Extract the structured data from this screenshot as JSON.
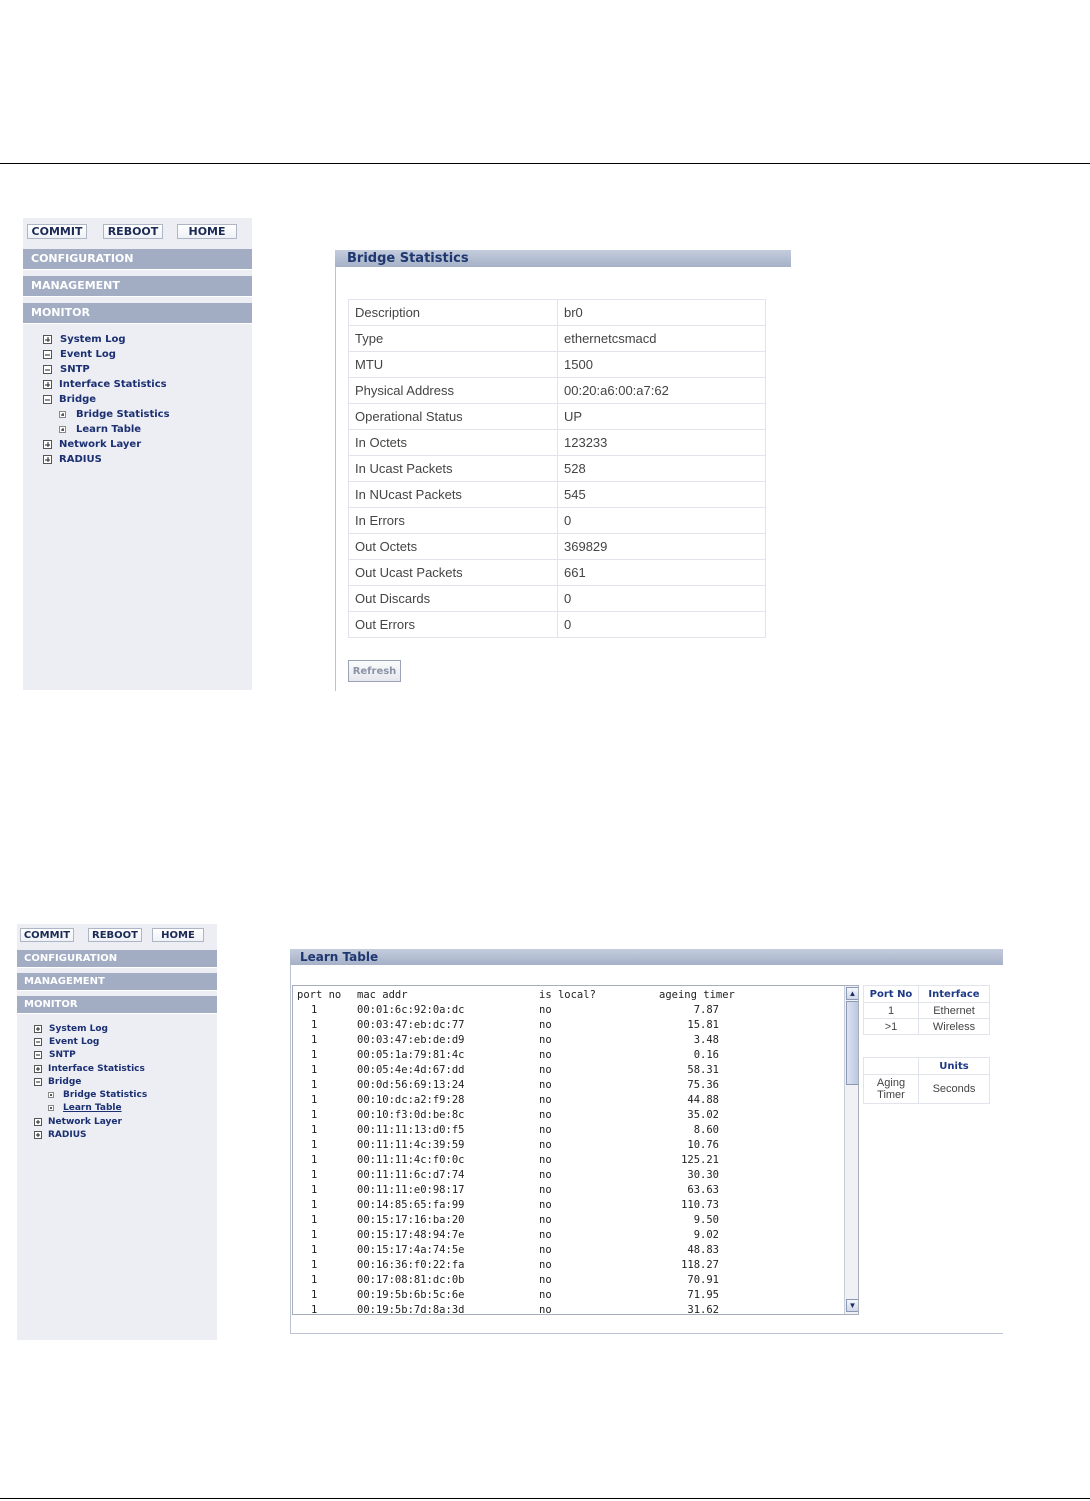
{
  "nav_buttons": {
    "commit": "COMMIT",
    "reboot": "REBOOT",
    "home": "HOME"
  },
  "sections": {
    "configuration": "CONFIGURATION",
    "management": "MANAGEMENT",
    "monitor": "MONITOR"
  },
  "tree": {
    "system_log": "System Log",
    "event_log": "Event Log",
    "sntp": "SNTP",
    "interface_statistics": "Interface Statistics",
    "bridge": "Bridge",
    "bridge_statistics": "Bridge Statistics",
    "learn_table": "Learn Table",
    "network_layer": "Network Layer",
    "radius": "RADIUS"
  },
  "bridge_statistics": {
    "title": "Bridge Statistics",
    "rows": [
      {
        "label": "Description",
        "value": "br0"
      },
      {
        "label": "Type",
        "value": "ethernetcsmacd"
      },
      {
        "label": "MTU",
        "value": "1500"
      },
      {
        "label": "Physical Address",
        "value": "00:20:a6:00:a7:62"
      },
      {
        "label": "Operational Status",
        "value": "UP"
      },
      {
        "label": "In Octets",
        "value": "123233"
      },
      {
        "label": "In Ucast Packets",
        "value": "528"
      },
      {
        "label": "In NUcast Packets",
        "value": "545"
      },
      {
        "label": "In Errors",
        "value": "0"
      },
      {
        "label": "Out Octets",
        "value": "369829"
      },
      {
        "label": "Out Ucast Packets",
        "value": "661"
      },
      {
        "label": "Out Discards",
        "value": "0"
      },
      {
        "label": "Out Errors",
        "value": "0"
      }
    ],
    "refresh_label": "Refresh"
  },
  "learn_table": {
    "title": "Learn Table",
    "headers": {
      "port": "port no",
      "mac": "mac addr",
      "local": "is local?",
      "age": "ageing timer"
    },
    "rows": [
      {
        "port": "1",
        "mac": "00:01:6c:92:0a:dc",
        "local": "no",
        "age": "7.87"
      },
      {
        "port": "1",
        "mac": "00:03:47:eb:dc:77",
        "local": "no",
        "age": "15.81"
      },
      {
        "port": "1",
        "mac": "00:03:47:eb:de:d9",
        "local": "no",
        "age": "3.48"
      },
      {
        "port": "1",
        "mac": "00:05:1a:79:81:4c",
        "local": "no",
        "age": "0.16"
      },
      {
        "port": "1",
        "mac": "00:05:4e:4d:67:dd",
        "local": "no",
        "age": "58.31"
      },
      {
        "port": "1",
        "mac": "00:0d:56:69:13:24",
        "local": "no",
        "age": "75.36"
      },
      {
        "port": "1",
        "mac": "00:10:dc:a2:f9:28",
        "local": "no",
        "age": "44.88"
      },
      {
        "port": "1",
        "mac": "00:10:f3:0d:be:8c",
        "local": "no",
        "age": "35.02"
      },
      {
        "port": "1",
        "mac": "00:11:11:13:d0:f5",
        "local": "no",
        "age": "8.60"
      },
      {
        "port": "1",
        "mac": "00:11:11:4c:39:59",
        "local": "no",
        "age": "10.76"
      },
      {
        "port": "1",
        "mac": "00:11:11:4c:f0:0c",
        "local": "no",
        "age": "125.21"
      },
      {
        "port": "1",
        "mac": "00:11:11:6c:d7:74",
        "local": "no",
        "age": "30.30"
      },
      {
        "port": "1",
        "mac": "00:11:11:e0:98:17",
        "local": "no",
        "age": "63.63"
      },
      {
        "port": "1",
        "mac": "00:14:85:65:fa:99",
        "local": "no",
        "age": "110.73"
      },
      {
        "port": "1",
        "mac": "00:15:17:16:ba:20",
        "local": "no",
        "age": "9.50"
      },
      {
        "port": "1",
        "mac": "00:15:17:48:94:7e",
        "local": "no",
        "age": "9.02"
      },
      {
        "port": "1",
        "mac": "00:15:17:4a:74:5e",
        "local": "no",
        "age": "48.83"
      },
      {
        "port": "1",
        "mac": "00:16:36:f0:22:fa",
        "local": "no",
        "age": "118.27"
      },
      {
        "port": "1",
        "mac": "00:17:08:81:dc:0b",
        "local": "no",
        "age": "70.91"
      },
      {
        "port": "1",
        "mac": "00:19:5b:6b:5c:6e",
        "local": "no",
        "age": "71.95"
      },
      {
        "port": "1",
        "mac": "00:19:5b:7d:8a:3d",
        "local": "no",
        "age": "31.62"
      }
    ],
    "port_legend": {
      "headers": [
        "Port No",
        "Interface"
      ],
      "rows": [
        [
          "1",
          "Ethernet"
        ],
        [
          ">1",
          "Wireless"
        ]
      ]
    },
    "units_legend": {
      "header": "Units",
      "label": "Aging Timer",
      "value": "Seconds"
    }
  },
  "scrollbar_icons": {
    "up": "arrow-up-icon",
    "down": "arrow-down-icon"
  }
}
